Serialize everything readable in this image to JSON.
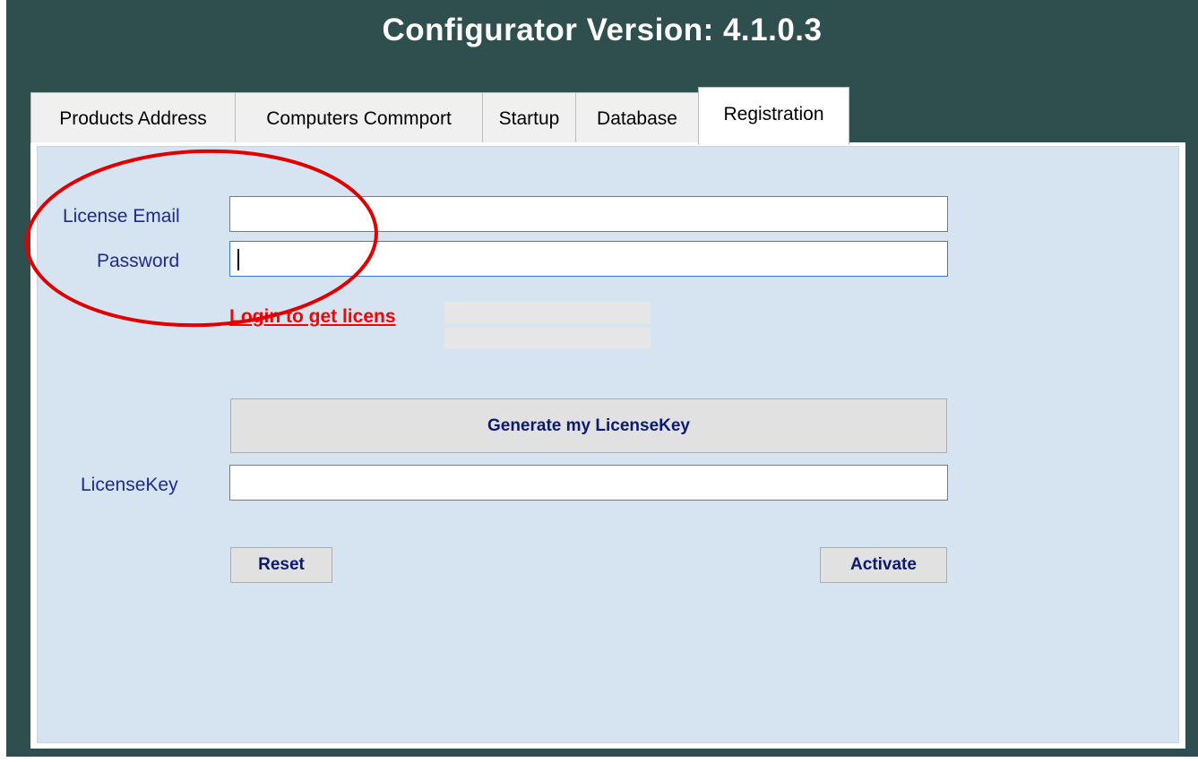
{
  "window": {
    "title": "Configurator Version: 4.1.0.3",
    "bg_color": "#2f4f4f"
  },
  "tabs": [
    {
      "label": "Products Address",
      "active": false
    },
    {
      "label": "Computers Commport",
      "active": false
    },
    {
      "label": "Startup",
      "active": false
    },
    {
      "label": "Database",
      "active": false
    },
    {
      "label": "Registration",
      "active": true
    }
  ],
  "form": {
    "license_email": {
      "label": "License Email",
      "value": ""
    },
    "password": {
      "label": "Password",
      "value": ""
    },
    "login_link": "Login to get licens",
    "generate_button": "Generate my LicenseKey",
    "license_key": {
      "label": "LicenseKey",
      "value": ""
    },
    "reset_button": "Reset",
    "activate_button": "Activate"
  },
  "colors": {
    "label_text": "#1f2a8a",
    "link": "#ff0000",
    "panel_bg": "#d6e4f2",
    "annotation": "#e00000"
  }
}
